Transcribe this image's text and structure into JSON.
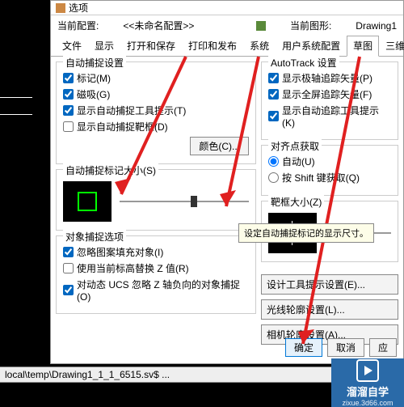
{
  "titlebar": "选项",
  "topRow": {
    "label1": "当前配置:",
    "value1": "<<未命名配置>>",
    "label2": "当前图形:",
    "value2": "Drawing1"
  },
  "tabs": {
    "t0": "文件",
    "t1": "显示",
    "t2": "打开和保存",
    "t3": "打印和发布",
    "t4": "系统",
    "t5": "用户系统配置",
    "t6": "草图",
    "t7": "三维建模"
  },
  "groups": {
    "autosnap": {
      "title": "自动捕捉设置",
      "marker": "标记(M)",
      "magnet": "磁吸(G)",
      "tooltip": "显示自动捕捉工具提示(T)",
      "aperture": "显示自动捕捉靶框(D)",
      "colorBtn": "颜色(C)..."
    },
    "markerSize": {
      "title": "自动捕捉标记大小(S)"
    },
    "osnapOpt": {
      "title": "对象捕捉选项",
      "c1": "忽略图案填充对象(I)",
      "c2": "使用当前标高替换 Z 值(R)",
      "c3": "对动态 UCS 忽略 Z 轴负向的对象捕捉(O)"
    },
    "autotrack": {
      "title": "AutoTrack 设置",
      "c1": "显示极轴追踪矢量(P)",
      "c2": "显示全屏追踪矢量(F)",
      "c3": "显示自动追踪工具提示(K)"
    },
    "align": {
      "title": "对齐点获取",
      "r1": "自动(U)",
      "r2": "按 Shift 键获取(Q)"
    },
    "targetSize": {
      "title": "靶框大小(Z)"
    },
    "sidebtns": {
      "b1": "设计工具提示设置(E)...",
      "b2": "光线轮廓设置(L)...",
      "b3": "相机轮廓设置(A)..."
    }
  },
  "tooltip": "设定自动捕捉标记的显示尺寸。",
  "buttons": {
    "ok": "确定",
    "cancel": "取消",
    "apply": "应"
  },
  "status": "local\\temp\\Drawing1_1_1_6515.sv$ ...",
  "wm": {
    "name": "溜溜自学",
    "url": "zixue.3d66.com"
  }
}
